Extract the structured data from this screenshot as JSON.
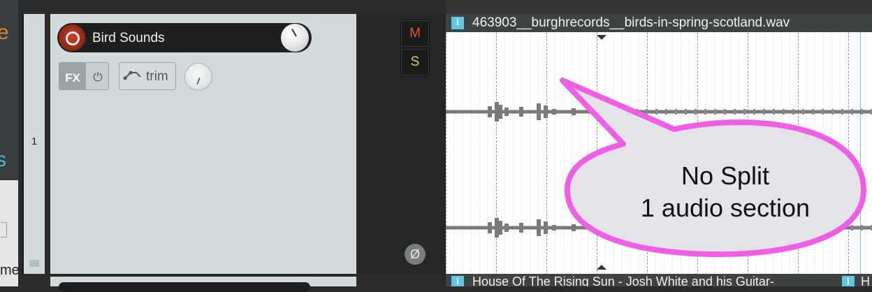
{
  "track": {
    "number": "1",
    "name": "Bird Sounds",
    "fx_label": "FX",
    "fx_power_icon": "power-icon",
    "trim_label": "trim",
    "mute_label": "M",
    "solo_label": "S",
    "phase_icon": "Ø"
  },
  "item": {
    "info_icon": "i",
    "title": "463903__burghrecords__birds-in-spring-scotland.wav"
  },
  "next_item": {
    "info_icon": "i",
    "title": "House Of The Rising Sun - Josh White and his Guitar-",
    "info_icon_2": "i",
    "title_2": "H"
  },
  "annotation": {
    "line1": "No Split",
    "line2": "1 audio section"
  },
  "side_peek": {
    "top_letter": "e",
    "mid_letter": "s",
    "bottom_text": "me"
  },
  "colors": {
    "tcp_bg": "#d3dadb",
    "record": "#b0301c",
    "mute": "#d9583d",
    "solo": "#d9cc5a",
    "info": "#5fc6e3",
    "bubble_stroke": "#ee5fe6",
    "bubble_fill": "#e4e4e8",
    "waveform": "#7a7a7a"
  }
}
